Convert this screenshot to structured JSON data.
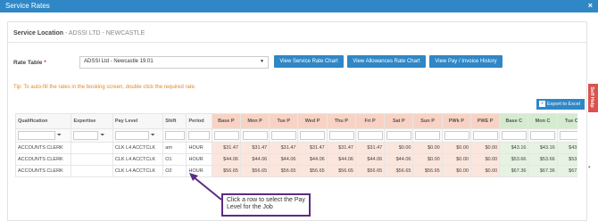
{
  "window": {
    "title": "Service Rates",
    "close": "×"
  },
  "section": {
    "label": "Service Location",
    "separator": " - ",
    "location": "ADSSI LTD - NEWCASTLE"
  },
  "rate_table": {
    "label": "Rate Table",
    "required_mark": "*",
    "selected": "ADSSI Ltd - Newcastle 19.01"
  },
  "buttons": {
    "service_rate_chart": "View Service Rate Chart",
    "allowances_rate_chart": "View Allowances Rate Chart",
    "pay_invoice_history": "View Pay / Invoice History",
    "export_excel": "Export to Excel"
  },
  "tip": "Tip: To auto-fill the rates in the booking screen, double click the required rate.",
  "self_help": "Self Help",
  "grid": {
    "columns": [
      "Qualification",
      "Expertise",
      "Pay Level",
      "Shift",
      "Period",
      "Base P",
      "Mon P",
      "Tue P",
      "Wed P",
      "Thu P",
      "Fri P",
      "Sat P",
      "Sun P",
      "PWk P",
      "PWE P",
      "Base C",
      "Mon C",
      "Tue C"
    ],
    "rows": [
      [
        "ACCOUNTS CLERK",
        "",
        "CLK L4 ACCTCLK",
        "am",
        "HOUR",
        "$31.47",
        "$31.47",
        "$31.47",
        "$31.47",
        "$31.47",
        "$31.47",
        "$0.00",
        "$0.00",
        "$0.00",
        "$0.00",
        "$43.16",
        "$43.16",
        "$43.16"
      ],
      [
        "ACCOUNTS CLERK",
        "",
        "CLK L4 ACCTCLK",
        "O1",
        "HOUR",
        "$44.06",
        "$44.06",
        "$44.06",
        "$44.06",
        "$44.06",
        "$44.06",
        "$44.06",
        "$0.00",
        "$0.00",
        "$0.00",
        "$53.66",
        "$53.66",
        "$53.66"
      ],
      [
        "ACCOUNTS CLERK",
        "",
        "CLK L4 ACCTCLK",
        "O2",
        "HOUR",
        "$56.65",
        "$56.65",
        "$56.65",
        "$56.65",
        "$56.65",
        "$56.65",
        "$56.65",
        "$56.65",
        "$0.00",
        "$0.00",
        "$67.36",
        "$67.36",
        "$67.36"
      ]
    ]
  },
  "callout": "Click a row to select the Pay Level for the Job",
  "colors": {
    "accent": "#2f87c6",
    "callout_border": "#5a2d82",
    "tip": "#e08a2d",
    "pink_header": "#f8d3c4",
    "green_header": "#d5ebd0"
  }
}
